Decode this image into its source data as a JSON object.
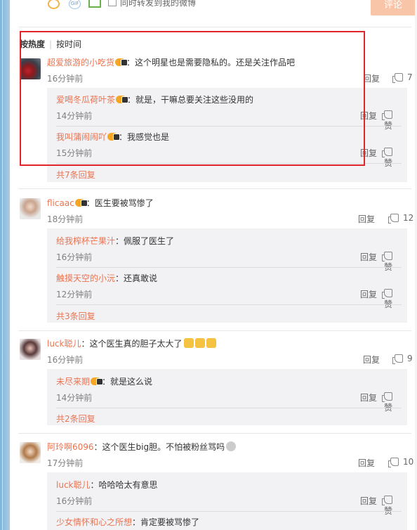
{
  "toolbar": {
    "repost_label": "同时转发到我的微博",
    "post_button": "评论",
    "gif_label": "GIF"
  },
  "sort": {
    "hot": "按热度",
    "time": "按时间"
  },
  "colors": {
    "accent": "#eb7350",
    "highlight": "#e0262b",
    "sub_bg": "#f2f2f5"
  },
  "comments": [
    {
      "user": "超爱旅游的小吃货",
      "text": "：这个明星也是需要隐私的。还是关注作品吧",
      "time": "16分钟前",
      "reply": "回复",
      "likes": "7",
      "subs": [
        {
          "user": "爱喝冬瓜荷叶茶",
          "text": "：就是，干嘛总要关注这些没用的",
          "time": "14分钟前",
          "reply": "回复",
          "like": "赞"
        },
        {
          "user": "我叫蒲闹闹吖",
          "text": "：我感觉也是",
          "time": "15分钟前",
          "reply": "回复",
          "like": "赞"
        }
      ],
      "more": "共7条回复"
    },
    {
      "user": "flicaac",
      "text": "：医生要被骂惨了",
      "time": "18分钟前",
      "reply": "回复",
      "likes": "12",
      "subs": [
        {
          "user": "给我榨杯芒果汁",
          "text": "：佩服了医生了",
          "time": "16分钟前",
          "reply": "回复",
          "like": "赞"
        },
        {
          "user": "触摸天空的小沅",
          "text": "：还真敢说",
          "time": "12分钟前",
          "reply": "回复",
          "like": "赞"
        }
      ],
      "more": "共3条回复"
    },
    {
      "user": "luck聪儿",
      "text": "：这个医生真的胆子太大了",
      "time": "16分钟前",
      "reply": "回复",
      "likes": "9",
      "subs": [
        {
          "user": "未尽来期",
          "text": "：就是这么说",
          "time": "14分钟前",
          "reply": "回复",
          "like": "赞"
        }
      ],
      "more": "共2条回复"
    },
    {
      "user": "阿玲啊6096",
      "text": "：这个医生big胆。不怕被粉丝骂吗",
      "time": "17分钟前",
      "reply": "回复",
      "likes": "10",
      "subs": [
        {
          "user": "luck聪儿",
          "text": "：哈哈哈太有意思",
          "time": "16分钟前",
          "reply": "回复",
          "like": "赞"
        },
        {
          "user": "少女情怀和心之所想",
          "text": "：肯定要被骂惨了",
          "time": "",
          "reply": "",
          "like": ""
        }
      ]
    }
  ]
}
